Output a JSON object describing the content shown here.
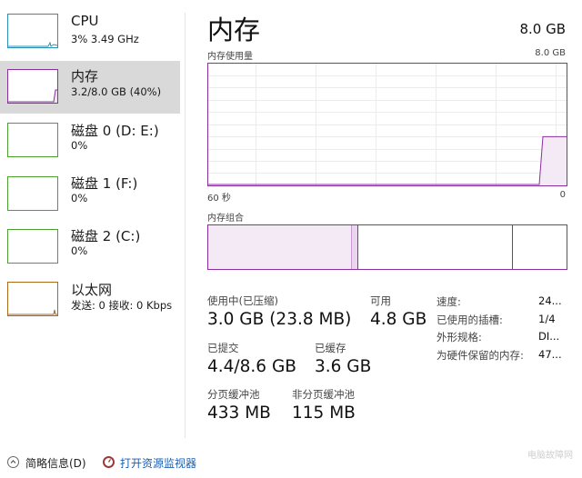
{
  "colors": {
    "cpu": "#2a8fb4",
    "memory": "#8b2fa0",
    "disk": "#4ca02f",
    "ethernet": "#a86a1c",
    "selected_bg": "#d9d9d9",
    "link": "#1a5fb4"
  },
  "sidebar": {
    "items": [
      {
        "title": "CPU",
        "sub": "3% 3.49 GHz",
        "icon": "cpu-graph",
        "level": 0.03
      },
      {
        "title": "内存",
        "sub": "3.2/8.0 GB (40%)",
        "icon": "memory-graph",
        "level": 0.4,
        "selected": true
      },
      {
        "title": "磁盘 0 (D: E:)",
        "sub": "0%",
        "icon": "disk-graph",
        "level": 0
      },
      {
        "title": "磁盘 1 (F:)",
        "sub": "0%",
        "icon": "disk-graph",
        "level": 0
      },
      {
        "title": "磁盘 2 (C:)",
        "sub": "0%",
        "icon": "disk-graph",
        "level": 0
      },
      {
        "title": "以太网",
        "sub": "发送: 0 接收: 0 Kbps",
        "icon": "ethernet-graph",
        "level": 0
      }
    ]
  },
  "main": {
    "title": "内存",
    "total": "8.0 GB",
    "usage_graph": {
      "label": "内存使用量",
      "max_label": "8.0 GB",
      "x_left": "60 秒",
      "x_right": "0",
      "current_fraction": 0.4
    },
    "composition": {
      "label": "内存组合",
      "in_use_fraction": 0.4,
      "modified_fraction": 0.02,
      "standby_fraction": 0.43,
      "free_fraction": 0.15
    },
    "stats": [
      {
        "label": "使用中(已压缩)",
        "value": "3.0 GB (23.8 MB)"
      },
      {
        "label": "可用",
        "value": "4.8 GB"
      },
      {
        "label": "已提交",
        "value": "4.4/8.6 GB"
      },
      {
        "label": "已缓存",
        "value": "3.6 GB"
      },
      {
        "label": "分页缓冲池",
        "value": "433 MB"
      },
      {
        "label": "非分页缓冲池",
        "value": "115 MB"
      }
    ],
    "details": [
      {
        "label": "速度:",
        "value": "24..."
      },
      {
        "label": "已使用的插槽:",
        "value": "1/4"
      },
      {
        "label": "外形规格:",
        "value": "DI..."
      },
      {
        "label": "为硬件保留的内存:",
        "value": "47..."
      }
    ]
  },
  "footer": {
    "summary_label": "简略信息(D)",
    "monitor_label": "打开资源监视器",
    "summary_icon": "collapse-chevron-icon",
    "monitor_icon": "resource-monitor-icon"
  },
  "watermark": "电脑故障网"
}
